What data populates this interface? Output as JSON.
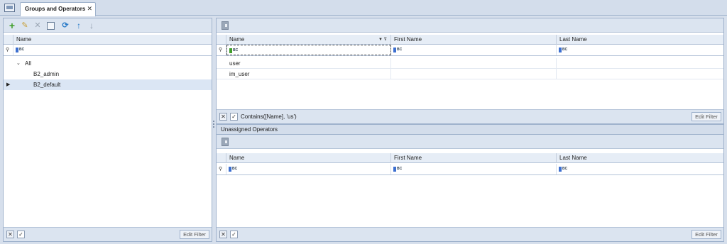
{
  "window": {
    "tab_title": "Groups and Operators",
    "close_glyph": "✕"
  },
  "groups_panel": {
    "column_name": "Name",
    "tree": {
      "root_label": "All",
      "items": [
        {
          "label": "B2_admin",
          "selected": false
        },
        {
          "label": "B2_default",
          "selected": true
        }
      ]
    },
    "footer": {
      "edit_filter": "Edit Filter"
    }
  },
  "operators_panel": {
    "columns": [
      "Name",
      "First Name",
      "Last Name"
    ],
    "rows": [
      {
        "name": "user",
        "first_name": "",
        "last_name": ""
      },
      {
        "name": "im_user",
        "first_name": "",
        "last_name": ""
      }
    ],
    "footer": {
      "filter_text": "Contains([Name], 'us')",
      "edit_filter": "Edit Filter"
    }
  },
  "unassigned_panel": {
    "title": "Unassigned Operators",
    "columns": [
      "Name",
      "First Name",
      "Last Name"
    ],
    "footer": {
      "edit_filter": "Edit Filter"
    }
  },
  "icons": {
    "abc_filter": "ABC",
    "colors": {
      "accent": "#3f9e2a",
      "refresh": "#2b7cc8",
      "header_bg": "#e6edf6",
      "selection": "#dbe6f4"
    }
  }
}
